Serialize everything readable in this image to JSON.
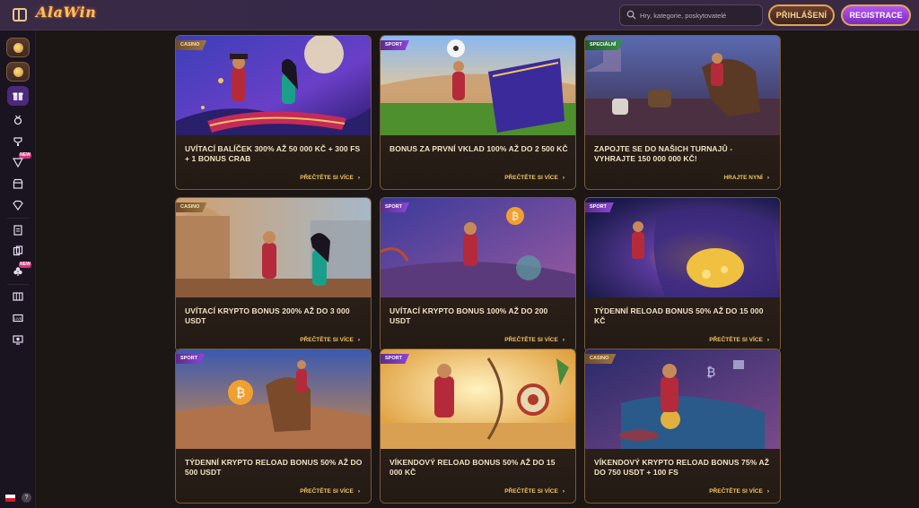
{
  "header": {
    "logo": "AlaWin",
    "search_placeholder": "Hry, kategorie, poskytovatelé",
    "login_label": "PŘIHLÁŠENÍ",
    "register_label": "REGISTRACE"
  },
  "sidebar": {
    "new_badge": "NEW",
    "help": "?"
  },
  "cards": [
    {
      "tag": "CASINO",
      "tag_type": "casino",
      "title": "Uvítací balíček 300% až 50 000 Kč + 300 FS + 1 bonus crab",
      "cta": "Přečtěte si více"
    },
    {
      "tag": "SPORT",
      "tag_type": "sport",
      "title": "Bonus za první vklad 100% až do 2 500 Kč",
      "cta": "Přečtěte si více"
    },
    {
      "tag": "SPECIÁLNÍ",
      "tag_type": "special",
      "title": "Zapojte se do našich turnajů - vyhrajte 150 000 000 Kč!",
      "cta": "Hrajte nyní"
    },
    {
      "tag": "CASINO",
      "tag_type": "casino",
      "title": "Uvítací krypto bonus 200% až do 3 000 USDT",
      "cta": "Přečtěte si více"
    },
    {
      "tag": "SPORT",
      "tag_type": "sport",
      "title": "Uvítací krypto bonus 100% až do 200 USDT",
      "cta": "Přečtěte si více"
    },
    {
      "tag": "SPORT",
      "tag_type": "sport",
      "title": "Týdenní reload bonus 50% až do 15 000 Kč",
      "cta": "Přečtěte si více"
    },
    {
      "tag": "SPORT",
      "tag_type": "sport",
      "title": "Týdenní krypto reload bonus 50% až do 500 USDT",
      "cta": "Přečtěte si více"
    },
    {
      "tag": "SPORT",
      "tag_type": "sport",
      "title": "Víkendový reload bonus 50% až do 15 000 Kč",
      "cta": "Přečtěte si více"
    },
    {
      "tag": "CASINO",
      "tag_type": "casino",
      "title": "Víkendový krypto reload bonus 75% až do 750 USDT + 100 FS",
      "cta": "Přečtěte si více"
    }
  ],
  "colors": {
    "accent_gold": "#f0c460",
    "register_purple": "#9b3fe0",
    "card_border": "#7a5a38",
    "tag_sport": "#8f46d8",
    "tag_casino": "#9e7540",
    "tag_special": "#37924a"
  }
}
